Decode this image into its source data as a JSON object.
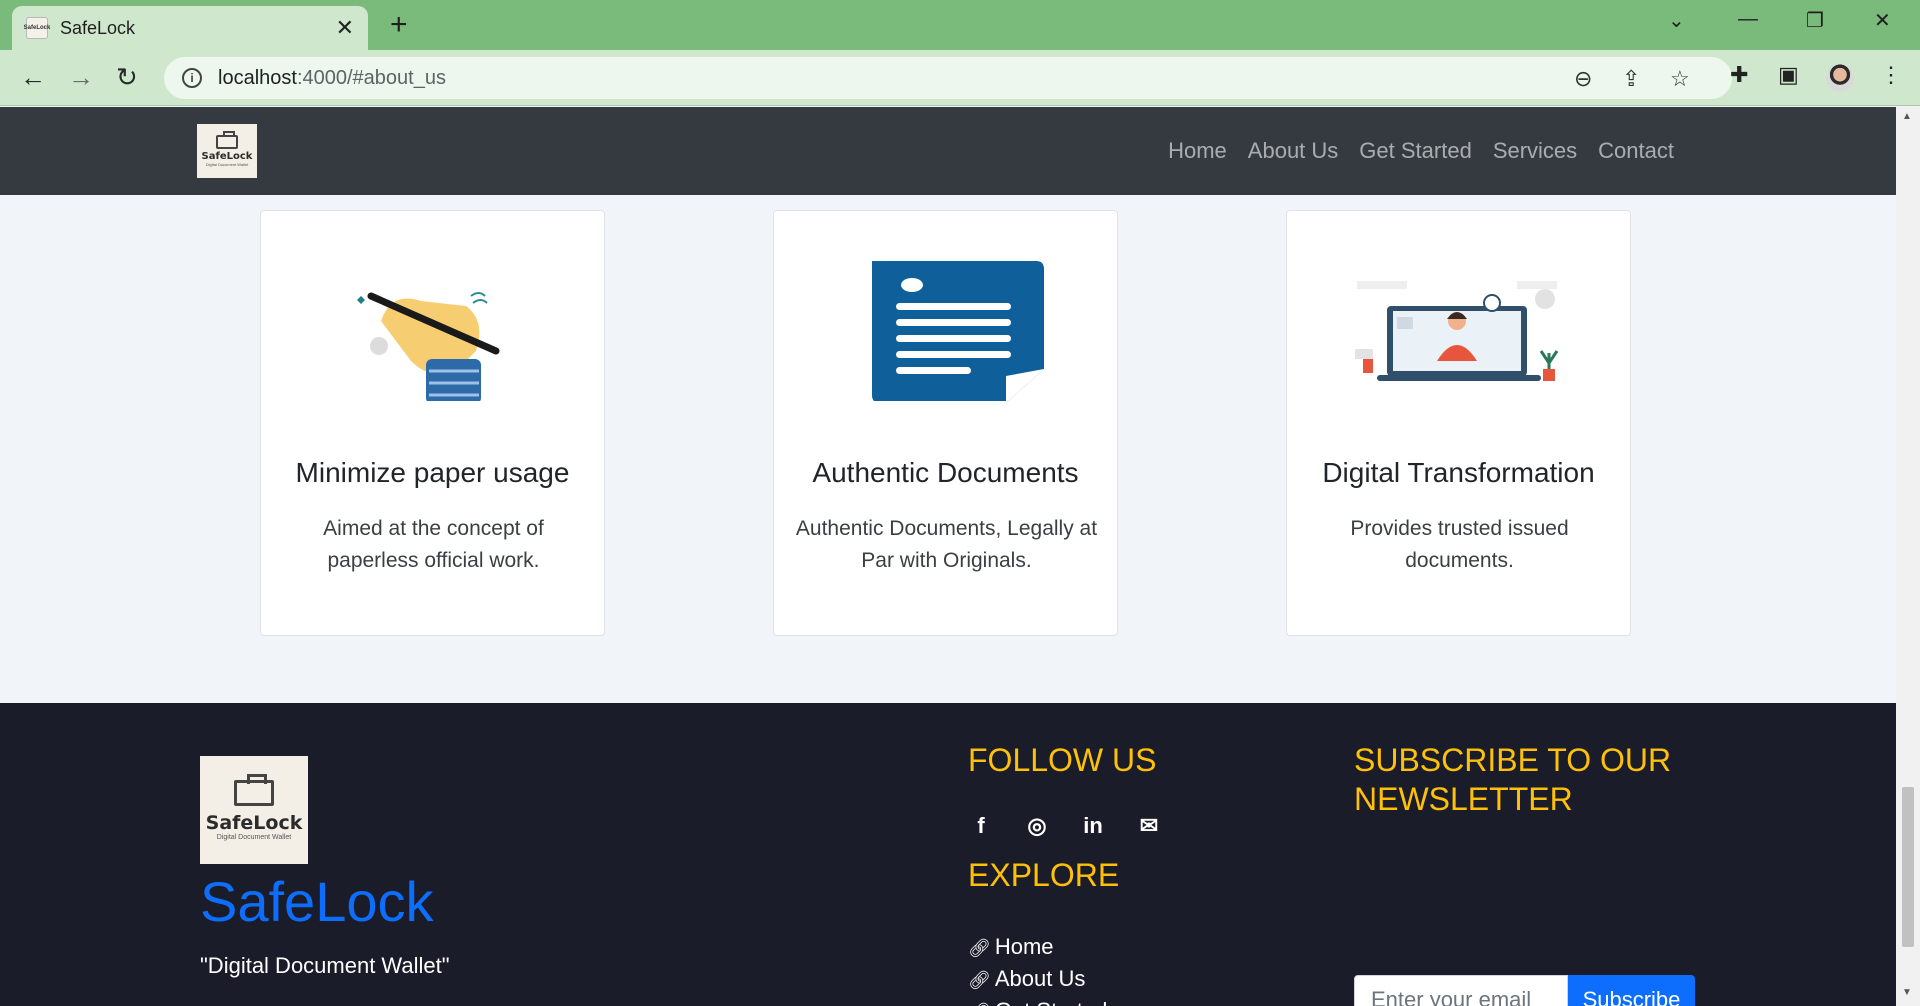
{
  "browser": {
    "tab_title": "SafeLock",
    "favicon_text": "SafeLock",
    "url_host": "localhost",
    "url_path": ":4000/#about_us",
    "icons": [
      "back-icon",
      "forward-icon",
      "reload-icon",
      "info-icon",
      "zoom-out-icon",
      "share-icon",
      "star-icon",
      "extensions-icon",
      "sidepanel-icon",
      "menu-icon"
    ]
  },
  "navbar": {
    "logo_name": "SafeLock",
    "logo_tagline": "Digital Document Wallet",
    "links": [
      "Home",
      "About Us",
      "Get Started",
      "Services",
      "Contact"
    ]
  },
  "features": [
    {
      "title": "Minimize paper usage",
      "text": "Aimed at the concept of paperless official work."
    },
    {
      "title": "Authentic Documents",
      "text": "Authentic Documents, Legally at Par with Originals."
    },
    {
      "title": "Digital Transformation",
      "text": "Provides trusted issued documents."
    }
  ],
  "footer": {
    "logo_name": "SafeLock",
    "logo_tagline": "Digital Document Wallet",
    "brand": "SafeLock",
    "tagline": "\"Digital Document Wallet\"",
    "follow_heading": "FOLLOW US",
    "social_icons": [
      "facebook-icon",
      "instagram-icon",
      "linkedin-icon",
      "envelope-icon"
    ],
    "explore_heading": "EXPLORE",
    "explore_links": [
      "Home",
      "About Us",
      "Get Started"
    ],
    "subscribe_heading": "SUBSCRIBE TO OUR NEWSLETTER",
    "email_placeholder": "Enter your email",
    "subscribe_button": "Subscribe"
  },
  "colors": {
    "accent_blue": "#0d6efd",
    "heading_yellow": "#ffc107",
    "nav_bg": "#343a40",
    "footer_bg": "#1b1c29",
    "tabstrip_green": "#7aba7a"
  }
}
